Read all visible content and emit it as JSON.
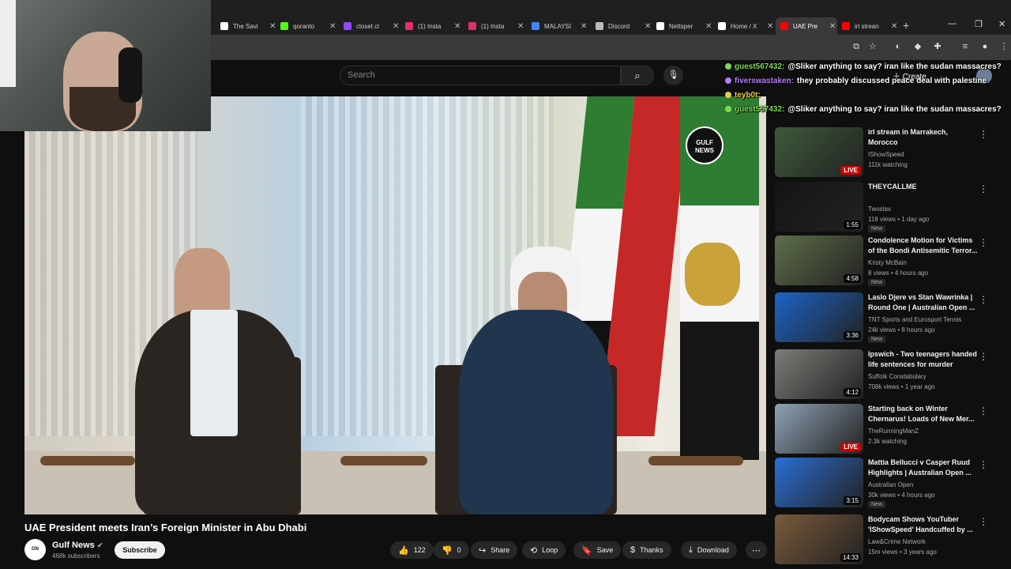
{
  "browser": {
    "tabs": [
      {
        "title": "The Savi",
        "icon": "x-icon",
        "color": "#ffffff"
      },
      {
        "title": "qoranto",
        "icon": "k-icon",
        "color": "#53fc18"
      },
      {
        "title": "closet cl",
        "icon": "twitch-icon",
        "color": "#9146ff"
      },
      {
        "title": "(1) Insta",
        "icon": "instagram-icon",
        "color": "#e1306c"
      },
      {
        "title": "(1) Insta",
        "icon": "instagram-icon",
        "color": "#e1306c"
      },
      {
        "title": "MALAYSI",
        "icon": "google-icon",
        "color": "#4285f4"
      },
      {
        "title": "Discord",
        "icon": "discord-icon",
        "color": "#bbbbbb"
      },
      {
        "title": "Nettsper",
        "icon": "x-icon",
        "color": "#ffffff"
      },
      {
        "title": "Home / X",
        "icon": "x-icon",
        "color": "#ffffff"
      },
      {
        "title": "UAE Pre",
        "icon": "youtube-icon",
        "color": "#ff0000"
      },
      {
        "title": "irl strean",
        "icon": "youtube-icon",
        "color": "#ff0000"
      }
    ],
    "active_tab": 9
  },
  "header": {
    "search_placeholder": "Search",
    "create_label": "Create"
  },
  "video": {
    "title": "UAE President meets Iran’s Foreign Minister in Abu Dhabi",
    "channel": "Gulf News",
    "subscribers": "468k subscribers",
    "subscribe_label": "Subscribe",
    "likes": "122",
    "dislikes": "0",
    "share_label": "Share",
    "loop_label": "Loop",
    "save_label": "Save",
    "thanks_label": "Thanks",
    "download_label": "Download",
    "logo_text": "GULF NEWS"
  },
  "chat": [
    {
      "user": "guest567432:",
      "text": "@Sliker anything to say? iran like the sudan massacres?",
      "user_color": "#7ed957"
    },
    {
      "user": "fiverswastaken:",
      "text": "they probably discussed peace deal with palestine",
      "user_color": "#b47cff"
    },
    {
      "user": "teyb0t:",
      "text": "",
      "user_color": "#e6c84f"
    },
    {
      "user": "guest567432:",
      "text": "@Sliker anything to say? iran like the sudan massacres?",
      "user_color": "#7ed957"
    }
  ],
  "recommendations": [
    {
      "title": "irl stream in Marrakech, Morocco",
      "channel": "IShowSpeed",
      "views": "111k watching",
      "badge": "LIVE",
      "new": "",
      "thumb": "#3e5a3a"
    },
    {
      "title": "THEYCALLME",
      "channel": "Twoslav",
      "views": "118 views • 1 day ago",
      "badge": "1:55",
      "new": "New",
      "thumb": "#141414"
    },
    {
      "title": "Condolence Motion for Victims of the Bondi Antisemitic Terror...",
      "channel": "Kristy McBain",
      "views": "8 views • 4 hours ago",
      "badge": "4:58",
      "new": "New",
      "thumb": "#5f6e4a"
    },
    {
      "title": "Laslo Djere vs Stan Wawrinka | Round One | Australian Open ...",
      "channel": "TNT Sports and Eurosport Tennis",
      "views": "24k views • 8 hours ago",
      "badge": "3:36",
      "new": "New",
      "thumb": "#1d63c7"
    },
    {
      "title": "Ipswich - Two teenagers handed life sentences for murder",
      "channel": "Suffolk Constabulary",
      "views": "708k views • 1 year ago",
      "badge": "4:12",
      "new": "",
      "thumb": "#7c7c78"
    },
    {
      "title": "Starting back on Winter Chernarus! Loads of New Mer...",
      "channel": "TheRunningManZ",
      "views": "2.3k watching",
      "badge": "LIVE",
      "new": "",
      "thumb": "#8fa2b5"
    },
    {
      "title": "Mattia Bellucci v Casper Ruud Highlights | Australian Open ...",
      "channel": "Australian Open",
      "views": "30k views • 4 hours ago",
      "badge": "3:15",
      "new": "New",
      "thumb": "#2a6fd4"
    },
    {
      "title": "Bodycam Shows YouTuber 'IShowSpeed' Handcuffed by ...",
      "channel": "Law&Crime Network",
      "views": "15m views • 3 years ago",
      "badge": "14:33",
      "new": "",
      "thumb": "#7a5a3c"
    }
  ],
  "colors": {
    "background": "#0f0f0f",
    "live_badge": "#cc0000",
    "accent": "#ff0000"
  }
}
